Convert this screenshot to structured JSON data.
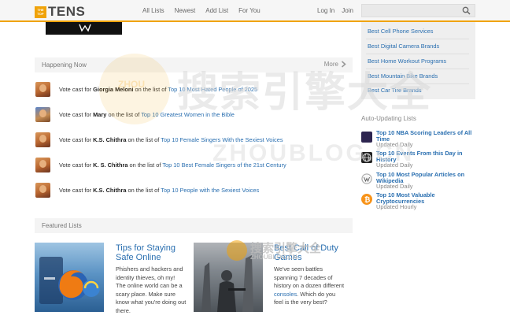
{
  "header": {
    "logo_badge": "THE TOP",
    "logo_text": "TENS",
    "nav": [
      "All Lists",
      "Newest",
      "Add List",
      "For You"
    ],
    "login": "Log In",
    "join": "Join",
    "search_placeholder": ""
  },
  "happening": {
    "title": "Happening Now",
    "more": "More",
    "items": [
      {
        "prefix": "Vote cast for ",
        "name": "Giorgia Meloni",
        "middle": " on the list of ",
        "list": "Top 10 Most Hated People of 2025"
      },
      {
        "prefix": "Vote cast for ",
        "name": "Mary",
        "middle": " on the list of ",
        "list": "Top 10 Greatest Women in the Bible"
      },
      {
        "prefix": "Vote cast for ",
        "name": "K.S. Chithra",
        "middle": " on the list of ",
        "list": "Top 10 Female Singers With the Sexiest Voices"
      },
      {
        "prefix": "Vote cast for ",
        "name": "K. S. Chithra",
        "middle": " on the list of ",
        "list": "Top 10 Best Female Singers of the 21st Century"
      },
      {
        "prefix": "Vote cast for ",
        "name": "K.S. Chithra",
        "middle": " on the list of ",
        "list": "Top 10 People with the Sexiest Voices"
      }
    ]
  },
  "featured": {
    "title": "Featured Lists",
    "cards": [
      {
        "title": "Tips for Staying Safe Online",
        "desc": [
          "Phishers and hackers and",
          "identity thieves, oh my!",
          "The online world can be a",
          "scary place. Make sure",
          "know what you're doing out",
          "there."
        ]
      },
      {
        "title": "Best Call of Duty Games",
        "desc_start": [
          "We've seen battles",
          "spanning 7 decades of",
          "history on a dozen different"
        ],
        "desc_link": "consoles",
        "desc_after_link": ". Which do you",
        "desc_end": [
          "feel is the very best?"
        ]
      }
    ]
  },
  "sidebar": {
    "links": [
      "Best Cell Phone Services",
      "Best Digital Camera Brands",
      "Best Home Workout Programs",
      "Best Mountain Bike Brands",
      "Best Car Tire Brands"
    ],
    "auto_title": "Auto-Updating Lists",
    "auto": [
      {
        "title": "Top 10 NBA Scoring Leaders of All Time",
        "status": "Updated Daily",
        "icon": "nba-icon"
      },
      {
        "title": "Top 10 Events From this Day in History",
        "status": "Updated Daily",
        "icon": "globe-icon"
      },
      {
        "title": "Top 10 Most Popular Articles on Wikipedia",
        "status": "Updated Daily",
        "icon": "wikipedia-icon"
      },
      {
        "title": "Top 10 Most Valuable Cryptocurrencies",
        "status": "Updated Hourly",
        "icon": "bitcoin-icon"
      }
    ]
  },
  "watermark": {
    "cn": "搜索引擎大全",
    "en": "ZHOUBLOG.CN",
    "badge": "ZHOU",
    "small_cn": "搜索引擎大全",
    "small_en": "ZHOUBLOG.CN"
  },
  "colors": {
    "accent": "#f0a30a",
    "link": "#2a6fb0"
  }
}
